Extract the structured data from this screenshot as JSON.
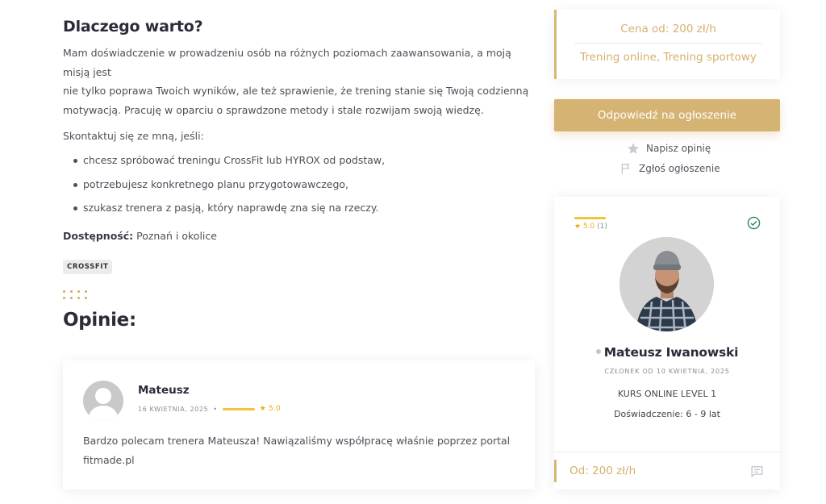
{
  "why": {
    "heading": "Dlaczego warto?",
    "paragraph_lines": [
      "Mam doświadczenie w prowadzeniu osób na różnych poziomach zaawansowania, a moją misją jest",
      "nie tylko poprawa Twoich wyników, ale też sprawienie, że trening stanie się Twoją codzienną",
      "motywacją. Pracuję w oparciu o sprawdzone metody i stale rozwijam swoją wiedzę."
    ],
    "contact_intro": "Skontaktuj się ze mną, jeśli:",
    "bullets": [
      "chcesz spróbować treningu CrossFit lub HYROX od podstaw,",
      "potrzebujesz konkretnego planu przygotowawczego,",
      "szukasz trenera z pasją, który naprawdę zna się na rzeczy."
    ],
    "availability_label": "Dostępność:",
    "availability_value": "Poznań i okolice",
    "tag": "CROSSFIT"
  },
  "opinions": {
    "heading": "Opinie:",
    "review": {
      "author": "Mateusz",
      "date": "16 KWIETNIA, 2025",
      "separator": "•",
      "rating_text": "★ 5.0",
      "rating": 5.0,
      "text_lines": [
        "Bardzo polecam trenera Mateusza! Nawiązaliśmy współpracę właśnie poprzez portal",
        "fitmade.pl"
      ]
    }
  },
  "sidebar": {
    "price_from": "Cena od: 200 zł/h",
    "categories": "Trening online, Trening sportowy",
    "reply_button": "Odpowiedź na ogłoszenie",
    "write_review": "Napisz opinię",
    "report_listing": "Zgłoś ogłoszenie"
  },
  "profile": {
    "rating_value": "★ 5.0",
    "rating_count": "(1)",
    "name": "Mateusz Iwanowski",
    "member_since": "CZŁONEK OD 10 KWIETNIA, 2025",
    "course": "KURS ONLINE LEVEL 1",
    "experience": "Doświadczenie: 6 - 9 lat",
    "price": "Od: 200 zł/h"
  },
  "colors": {
    "accent_gold": "#d5b373",
    "rating_yellow": "#f2c33b",
    "verified_green": "#2e8b57",
    "heading_dark": "#2b2b3a"
  },
  "icons": {
    "write_review": "star-icon",
    "report_listing": "flag-icon",
    "verified": "check-circle-icon",
    "message": "chat-icon"
  }
}
